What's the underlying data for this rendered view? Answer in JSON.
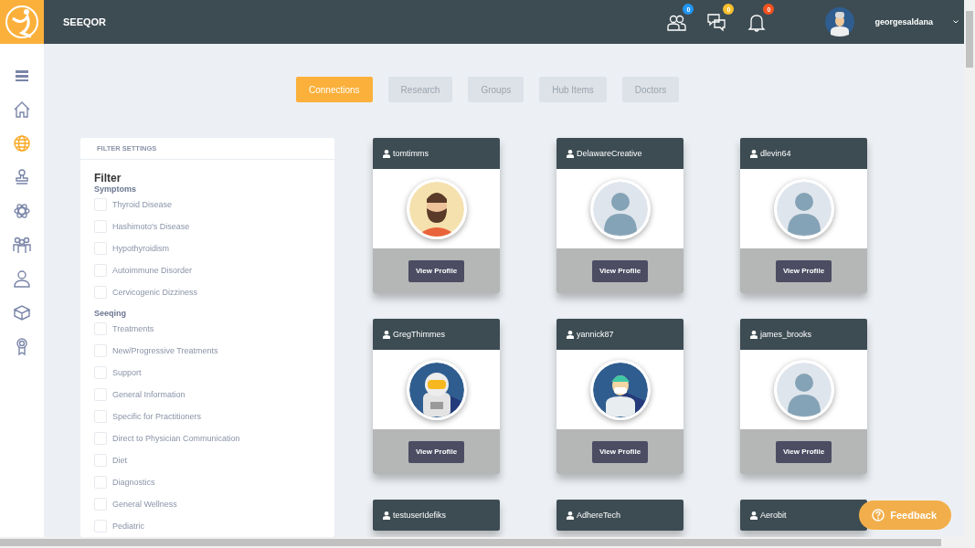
{
  "header": {
    "brand": "SEEQOR",
    "notifications": [
      {
        "count": "0",
        "color": "#2196f3"
      },
      {
        "count": "0",
        "color": "#fbc02d"
      },
      {
        "count": "0",
        "color": "#f4511e"
      }
    ],
    "user": {
      "name": "georgesaldana"
    }
  },
  "sidebar": {
    "items": [
      {
        "selected": false
      },
      {
        "selected": false
      },
      {
        "selected": true
      },
      {
        "selected": false
      },
      {
        "selected": false
      },
      {
        "selected": false
      },
      {
        "selected": false
      },
      {
        "selected": false
      },
      {
        "selected": false
      }
    ]
  },
  "tabs": [
    {
      "label": "Connections",
      "selected": true
    },
    {
      "label": "Research",
      "selected": false
    },
    {
      "label": "Groups",
      "selected": false
    },
    {
      "label": "Hub Items",
      "selected": false
    },
    {
      "label": "Doctors",
      "selected": false
    }
  ],
  "filter": {
    "header": "FILTER SETTINGS",
    "title": "Filter",
    "groups": [
      {
        "name": "Symptoms",
        "options": [
          {
            "label": "Thyroid Disease",
            "checked": false
          },
          {
            "label": "Hashimoto's Disease",
            "checked": false
          },
          {
            "label": "Hypothyroidism",
            "checked": false
          },
          {
            "label": "Autoimmune Disorder",
            "checked": false
          },
          {
            "label": "Cervicogenic Dizziness",
            "checked": false
          }
        ]
      },
      {
        "name": "Seeqing",
        "options": [
          {
            "label": "Treatments",
            "checked": false
          },
          {
            "label": "New/Progressive Treatments",
            "checked": false
          },
          {
            "label": "Support",
            "checked": false
          },
          {
            "label": "General Information",
            "checked": false
          },
          {
            "label": "Specific for Practitioners",
            "checked": false
          },
          {
            "label": "Direct to Physician Communication",
            "checked": false
          },
          {
            "label": "Diet",
            "checked": false
          },
          {
            "label": "Diagnostics",
            "checked": false
          },
          {
            "label": "General Wellness",
            "checked": false
          },
          {
            "label": "Pediatric",
            "checked": false
          }
        ]
      }
    ]
  },
  "cards": [
    {
      "username": "tomtimms",
      "avatar": {
        "kind": "beard"
      },
      "button": "View Profile"
    },
    {
      "username": "DelawareCreative",
      "avatar": {
        "kind": "placeholder"
      },
      "button": "View Profile"
    },
    {
      "username": "dlevin64",
      "avatar": {
        "kind": "placeholder"
      },
      "button": "View Profile"
    },
    {
      "username": "GregThimmes",
      "avatar": {
        "kind": "astronaut"
      },
      "button": "View Profile"
    },
    {
      "username": "yannick87",
      "avatar": {
        "kind": "surgeon"
      },
      "button": "View Profile"
    },
    {
      "username": "james_brooks",
      "avatar": {
        "kind": "placeholder"
      },
      "button": "View Profile"
    },
    {
      "username": "testuserIdefiks"
    },
    {
      "username": "AdhereTech"
    },
    {
      "username": "Aerobit"
    }
  ],
  "feedback": {
    "label": "Feedback"
  }
}
